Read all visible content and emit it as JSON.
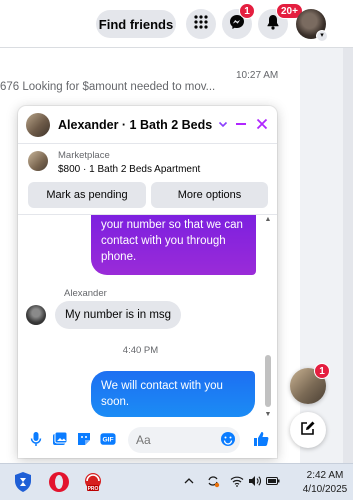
{
  "topbar": {
    "find_friends_label": "Find friends",
    "messenger_badge": "1",
    "notifications_badge": "20+"
  },
  "background": {
    "conversation_time": "10:27 AM",
    "conversation_preview": "676 Looking for $amount needed to mov..."
  },
  "chat": {
    "title": "Alexander · 1 Bath 2 Beds ...",
    "marketplace_label": "Marketplace",
    "listing": "$800 · 1 Bath 2 Beds Apartment",
    "mark_pending_label": "Mark as pending",
    "more_options_label": "More options",
    "messages": {
      "outgoing_1": "your number so that we can contact with you through phone.",
      "sender_name": "Alexander",
      "incoming_1": "My number is in msg",
      "timestamp": "4:40 PM",
      "outgoing_2": "We will contact with you soon."
    },
    "composer_placeholder": "Aa",
    "accent_color": "#0a7cff"
  },
  "floating": {
    "avatar_badge": "1"
  },
  "taskbar": {
    "time": "2:42 AM",
    "date": "4/10/2025"
  }
}
